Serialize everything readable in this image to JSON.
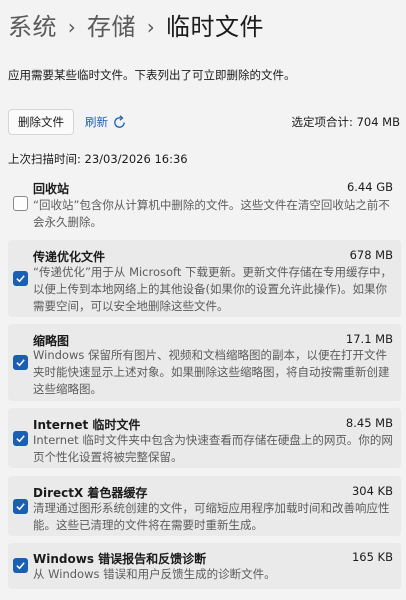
{
  "breadcrumb": {
    "items": [
      "系统",
      "存储"
    ],
    "current": "临时文件"
  },
  "description": "应用需要某些临时文件。下表列出了可立即删除的文件。",
  "toolbar": {
    "delete_label": "删除文件",
    "refresh_label": "刷新",
    "selected_total": "选定项合计: 704 MB"
  },
  "last_scan": "上次扫描时间: 23/03/2026 16:36",
  "items": [
    {
      "title": "回收站",
      "size": "6.44 GB",
      "checked": false,
      "description": "“回收站”包含你从计算机中删除的文件。这些文件在清空回收站之前不会永久删除。"
    },
    {
      "title": "传递优化文件",
      "size": "678 MB",
      "checked": true,
      "description": "“传递优化”用于从 Microsoft 下载更新。更新文件存储在专用缓存中，以便上传到本地网络上的其他设备(如果你的设置允许此操作)。如果你需要空间，可以安全地删除这些文件。"
    },
    {
      "title": "缩略图",
      "size": "17.1 MB",
      "checked": true,
      "description": "Windows 保留所有图片、视频和文档缩略图的副本，以便在打开文件夹时能快速显示上述对象。如果删除这些缩略图，将自动按需重新创建这些缩略图。"
    },
    {
      "title": "Internet 临时文件",
      "size": "8.45 MB",
      "checked": true,
      "description": "Internet 临时文件夹中包含为快速查看而存储在硬盘上的网页。你的网页个性化设置将被完整保留。"
    },
    {
      "title": "DirectX 着色器缓存",
      "size": "304 KB",
      "checked": true,
      "description": "清理通过图形系统创建的文件，可缩短应用程序加载时间和改善响应性能。这些已清理的文件将在需要时重新生成。"
    },
    {
      "title": "Windows 错误报告和反馈诊断",
      "size": "165 KB",
      "checked": true,
      "description": "从 Windows 错误和用户反馈生成的诊断文件。"
    }
  ]
}
